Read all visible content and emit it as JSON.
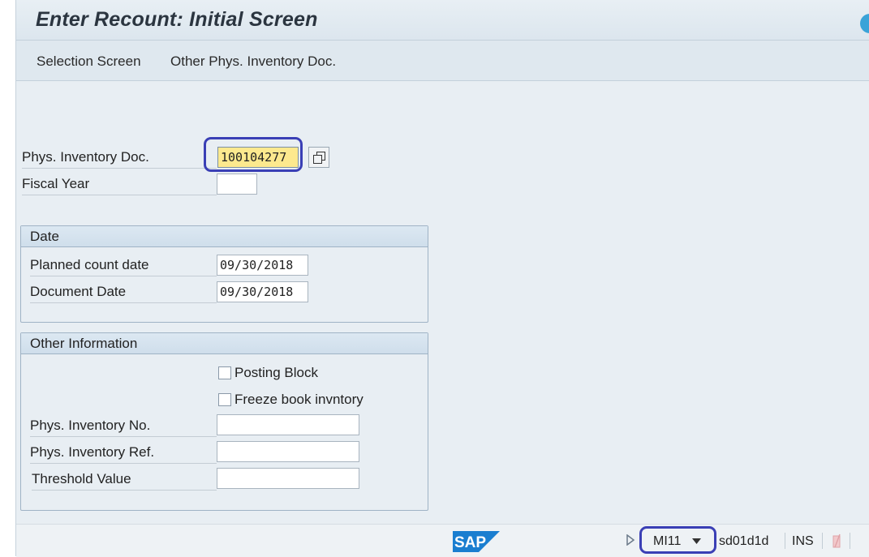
{
  "title": "Enter Recount: Initial Screen",
  "toolbar": {
    "selection_screen": "Selection Screen",
    "other_doc": "Other Phys. Inventory Doc."
  },
  "header_fields": {
    "phys_inv_doc_label": "Phys. Inventory Doc.",
    "phys_inv_doc_value": "100104277",
    "fiscal_year_label": "Fiscal Year",
    "fiscal_year_value": ""
  },
  "date_group": {
    "title": "Date",
    "planned_label": "Planned count date",
    "planned_value": "09/30/2018",
    "document_label": "Document Date",
    "document_value": "09/30/2018"
  },
  "other_group": {
    "title": "Other Information",
    "posting_block": "Posting Block",
    "freeze_book": "Freeze book invntory",
    "phys_inv_no_label": "Phys. Inventory No.",
    "phys_inv_ref_label": "Phys. Inventory Ref.",
    "threshold_label": "Threshold Value"
  },
  "status": {
    "brand": "SAP",
    "transaction": "MI11",
    "system": "sd01d1d",
    "mode": "INS"
  },
  "colors": {
    "highlight": "#3a3fb5",
    "focus_field": "#fde98e",
    "sap_blue": "#1a7ed0"
  }
}
